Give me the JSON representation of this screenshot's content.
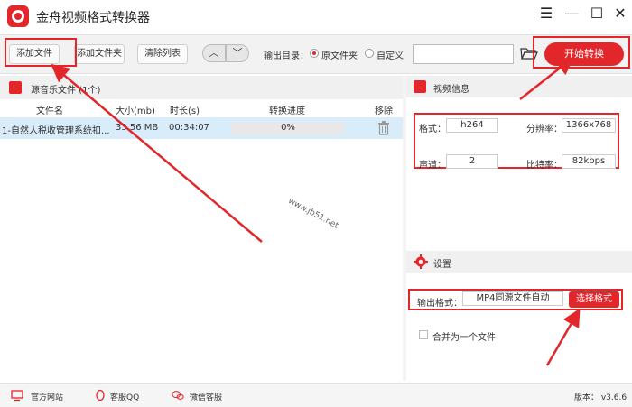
{
  "app": {
    "title": "金舟视频格式转换器"
  },
  "window_controls": [
    "menu-icon",
    "minimize-icon",
    "maximize-icon",
    "close-icon"
  ],
  "toolbar": {
    "add_file": "添加文件",
    "add_folder": "添加文件夹",
    "clear_list": "清除列表",
    "output_dir_label": "输出目录：",
    "radio_original": "原文件夹",
    "radio_custom": "自定义",
    "start_convert": "开始转换"
  },
  "list": {
    "header": "源音乐文件 (1个)",
    "columns": [
      "文件名",
      "大小(mb)",
      "时长(s)",
      "转换进度",
      "移除"
    ],
    "rows": [
      {
        "name": "1-自然人税收管理系统扣...",
        "size": "33.56 MB",
        "duration": "00:34:07",
        "progress": "0%"
      }
    ]
  },
  "video_info": {
    "header": "视频信息",
    "format_label": "格式：",
    "format_value": "h264",
    "resolution_label": "分辨率：",
    "resolution_value": "1366x768",
    "channel_label": "声道：",
    "channel_value": "2",
    "bitrate_label": "比特率：",
    "bitrate_value": "82kbps"
  },
  "settings": {
    "header": "设置",
    "output_format_label": "输出格式：",
    "output_format_value": "MP4同源文件自动",
    "choose_format": "选择格式",
    "merge_label": "合并为一个文件"
  },
  "statusbar": {
    "website": "官方网站",
    "qq": "客服QQ",
    "wechat": "微信客服",
    "version": "版本： v3.6.6"
  },
  "watermark": "www.jb51.net",
  "colors": {
    "accent": "#e3262a",
    "selected_row": "#d8ecfa"
  }
}
